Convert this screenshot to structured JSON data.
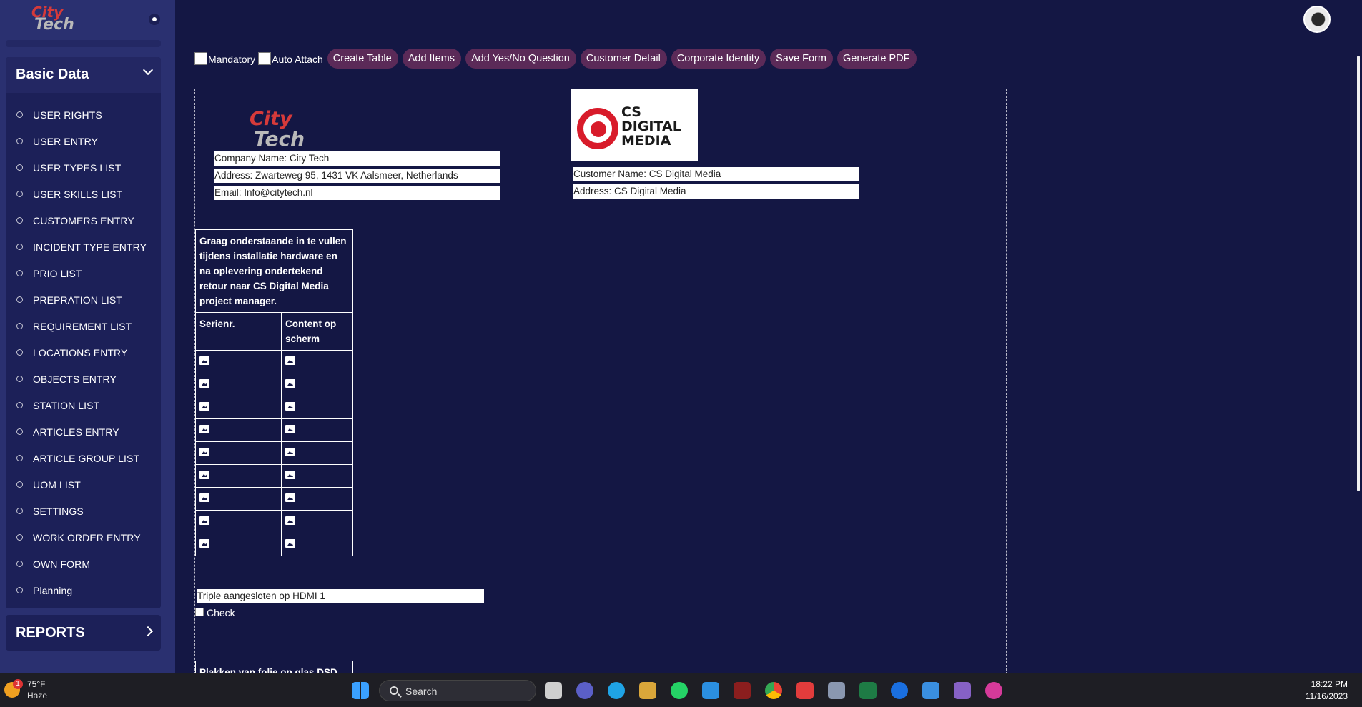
{
  "brand": {
    "logo_line1": "City",
    "logo_line2": "Tech"
  },
  "sidebar": {
    "basic_title": "Basic Data",
    "items": [
      "USER RIGHTS",
      "USER ENTRY",
      "USER TYPES LIST",
      "USER SKILLS LIST",
      "CUSTOMERS ENTRY",
      "INCIDENT TYPE ENTRY",
      "PRIO LIST",
      "PREPRATION LIST",
      "REQUIREMENT LIST",
      "LOCATIONS ENTRY",
      "OBJECTS ENTRY",
      "STATION LIST",
      "ARTICLES ENTRY",
      "ARTICLE GROUP LIST",
      "UOM LIST",
      "SETTINGS",
      "WORK ORDER ENTRY",
      "OWN FORM",
      "Planning"
    ],
    "reports_title": "REPORTS"
  },
  "toolbar": {
    "mandatory": "Mandatory",
    "auto_attach": "Auto Attach",
    "buttons": [
      "Create Table",
      "Add Items",
      "Add Yes/No Question",
      "Customer Detail",
      "Corporate Identity",
      "Save Form",
      "Generate PDF"
    ]
  },
  "form": {
    "company_name": "Company Name: City Tech",
    "company_address": "Address: Zwarteweg 95, 1431 VK Aalsmeer, Netherlands",
    "company_email": "Email: Info@citytech.nl",
    "cs_logo_line1": "CS",
    "cs_logo_line2": "DIGITAL",
    "cs_logo_line3": "MEDIA",
    "customer_name": "Customer Name: CS Digital Media",
    "customer_address": "Address: CS Digital Media",
    "table": {
      "heading": "Graag onderstaande in te vullen tijdens installatie hardware en na oplevering ondertekend retour naar CS Digital Media project manager.",
      "col1": "Serienr.",
      "col2": "Content op scherm",
      "rows": 9
    },
    "text_item": "Triple aangesloten op HDMI 1",
    "check_label": "Check",
    "table2_heading": "Plakken van folie op glas DSD"
  },
  "taskbar": {
    "weather_temp": "75°F",
    "weather_desc": "Haze",
    "weather_badge": "1",
    "search": "Search",
    "time": "18:22 PM",
    "date": "11/16/2023"
  }
}
